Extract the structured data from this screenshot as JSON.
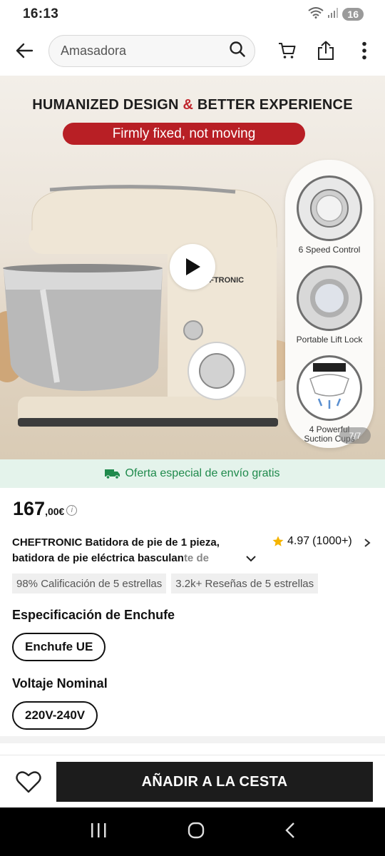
{
  "status_bar": {
    "time": "16:13",
    "battery": "16"
  },
  "search": {
    "query": "Amasadora"
  },
  "hero": {
    "headline_part1": "HUMANIZED DESIGN ",
    "headline_amp": "&",
    "headline_part2": " BETTER EXPERIENCE",
    "banner": "Firmly fixed, not moving",
    "brand": "CHEFTRONIC",
    "features": [
      {
        "label": "6 Speed Control"
      },
      {
        "label": "Portable Lift Lock"
      },
      {
        "label": "4 Powerful Suction Cups"
      }
    ],
    "image_counter": "7/7"
  },
  "shipping": {
    "text": "Oferta especial de envío gratis"
  },
  "price": {
    "integer": "167",
    "decimal": ",00€"
  },
  "product": {
    "title_line1": "CHEFTRONIC Batidora de pie de 1 pieza,",
    "title_line2_a": "batidora de pie eléctrica basculan",
    "title_line2_b": "te de",
    "rating": "4.97",
    "reviews": "(1000+)"
  },
  "tags": [
    "98% Calificación de 5 estrellas",
    "3.2k+ Reseñas de 5 estrellas"
  ],
  "specs": {
    "plug_title": "Especificación de Enchufe",
    "plug_value": "Enchufe UE",
    "voltage_title": "Voltaje Nominal",
    "voltage_value": "220V-240V"
  },
  "actions": {
    "add_to_cart": "AÑADIR A LA CESTA"
  },
  "colors": {
    "brand_red": "#b81f25",
    "shipping_green": "#1f8a4c",
    "star": "#f5b400",
    "cta_black": "#1c1c1c"
  }
}
